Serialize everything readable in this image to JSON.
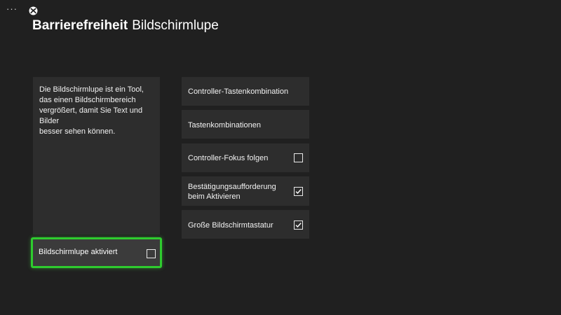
{
  "header": {
    "menu_glyph": "···",
    "logo_icon": "xbox-logo-icon",
    "section_title": "Barrierefreiheit",
    "page_title": "Bildschirmlupe"
  },
  "description": {
    "text": "Die Bildschirmlupe ist ein Tool,\ndas einen Bildschirmbereich\nvergrößert, damit Sie Text und\nBilder\nbesser sehen können."
  },
  "enable_toggle": {
    "label": "Bildschirmlupe aktiviert",
    "checked": false
  },
  "options": [
    {
      "label": "Controller-Tastenkombination"
    },
    {
      "label": "Tastenkombinationen"
    },
    {
      "label": "Controller-Fokus folgen",
      "checked": false
    },
    {
      "label": "Bestätigungsaufforderung\nbeim Aktivieren",
      "checked": true
    },
    {
      "label": "Große Bildschirmtastatur",
      "checked": true
    }
  ],
  "colors": {
    "background": "#202020",
    "tile": "#2d2d2d",
    "focus_border": "#2ecc2e"
  }
}
